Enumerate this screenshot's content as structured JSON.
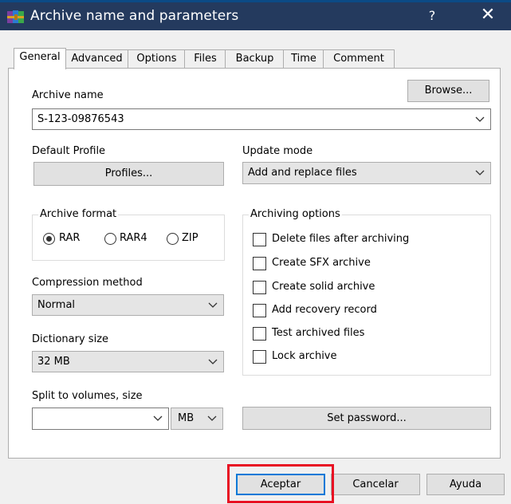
{
  "window": {
    "title": "Archive name and parameters",
    "help_glyph": "?",
    "close_glyph": "✕"
  },
  "tabs": [
    {
      "label": "General",
      "active": true
    },
    {
      "label": "Advanced"
    },
    {
      "label": "Options"
    },
    {
      "label": "Files"
    },
    {
      "label": "Backup"
    },
    {
      "label": "Time"
    },
    {
      "label": "Comment"
    }
  ],
  "general": {
    "archive_name_label": "Archive name",
    "browse_label": "Browse...",
    "archive_name_value": "S-123-09876543",
    "default_profile_label": "Default Profile",
    "profiles_label": "Profiles...",
    "update_mode_label": "Update mode",
    "update_mode_value": "Add and replace files",
    "archive_format": {
      "title": "Archive format",
      "options": [
        "RAR",
        "RAR4",
        "ZIP"
      ],
      "selected": "RAR"
    },
    "archiving_options": {
      "title": "Archiving options",
      "items": [
        "Delete files after archiving",
        "Create SFX archive",
        "Create solid archive",
        "Add recovery record",
        "Test archived files",
        "Lock archive"
      ]
    },
    "compression_method_label": "Compression method",
    "compression_method_value": "Normal",
    "dictionary_size_label": "Dictionary size",
    "dictionary_size_value": "32 MB",
    "split_label": "Split to volumes, size",
    "split_value": "",
    "split_unit": "MB",
    "set_password_label": "Set password..."
  },
  "footer": {
    "ok_label": "Aceptar",
    "cancel_label": "Cancelar",
    "help_label": "Ayuda"
  },
  "colors": {
    "titlebar": "#243a5e",
    "highlight": "#e81123",
    "focus": "#0078d7"
  }
}
